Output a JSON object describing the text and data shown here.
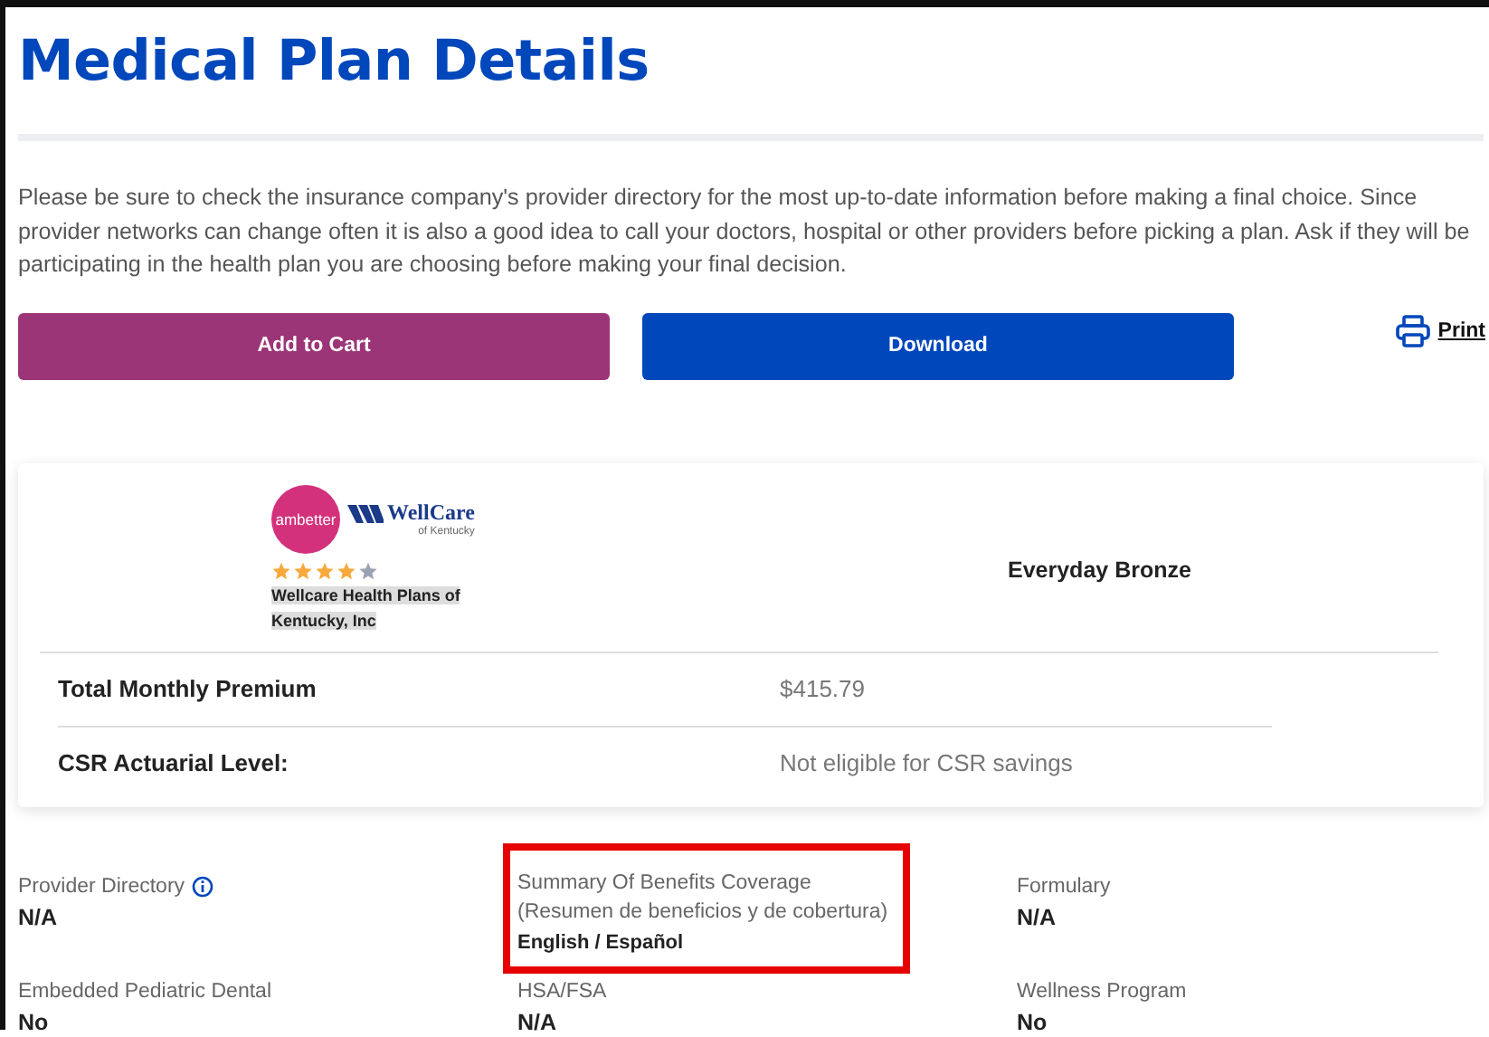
{
  "title": "Medical Plan Details",
  "notice": "Please be sure to check the insurance company's provider directory for the most up-to-date information before making a final choice. Since provider networks can change often it is also a good idea to call your doctors, hospital or other providers before picking a plan. Ask if they will be participating in the health plan you are choosing before making your final decision.",
  "actions": [
    {
      "label": "Add to Cart",
      "kind": "cart"
    },
    {
      "label": "Download",
      "kind": "download"
    }
  ],
  "print": {
    "label": "Print"
  },
  "plan": {
    "logo": {
      "left": "ambetter",
      "right": "WellCare",
      "right_sub": "of Kentucky"
    },
    "stars": 4,
    "issuer": "Wellcare Health Plans of Kentucky, Inc",
    "name": "Everyday Bronze",
    "rows": [
      {
        "label": "Total Monthly Premium",
        "value": "$415.79"
      },
      {
        "label": "CSR Actuarial Level:",
        "value": "Not eligible for CSR savings"
      }
    ]
  },
  "details": [
    {
      "label": "Provider Directory",
      "value": "N/A",
      "info": true,
      "highlighted": false
    },
    {
      "label": "Summary Of Benefits Coverage",
      "sublabel": "(Resumen de beneficios y de cobertura)",
      "links": [
        "English",
        "Español"
      ],
      "separator": "/",
      "info": false,
      "highlighted": true
    },
    {
      "label": "Formulary",
      "value": "N/A",
      "info": false,
      "highlighted": false
    },
    {
      "label": "Embedded Pediatric Dental",
      "value": "No",
      "info": false,
      "highlighted": false
    },
    {
      "label": "HSA/FSA",
      "value": "N/A",
      "info": false,
      "highlighted": false
    },
    {
      "label": "Wellness Program",
      "value": "No",
      "info": false,
      "highlighted": false
    }
  ]
}
